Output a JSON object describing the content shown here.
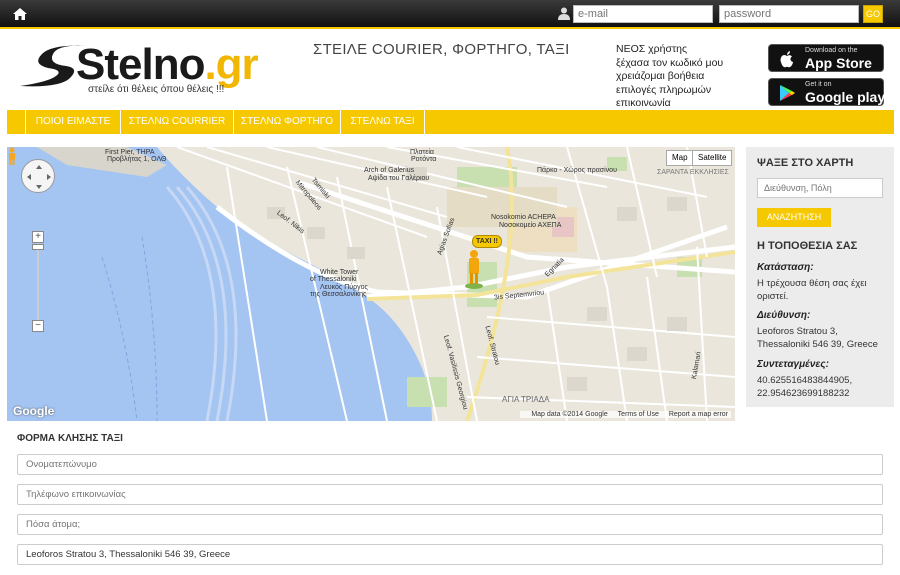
{
  "topbar": {
    "email_placeholder": "e-mail",
    "password_placeholder": "password",
    "go_label": "GO"
  },
  "header": {
    "logo_main": "Stelno",
    "logo_ext": ".gr",
    "logo_tagline": "στείλε ότι θέλεις όπου θέλεις !!!",
    "slogan": "ΣΤΕΙΛΕ COURIER, ΦΟΡΤΗΓΟ, ΤΑΞΙ",
    "links": [
      "ΝΕΟΣ χρήστης",
      "ξέχασα τον κωδικό μου",
      "χρειάζομαι βοήθεια",
      "επιλογές πληρωμών",
      "επικοινωνία"
    ],
    "app_store": {
      "small": "Download on the",
      "big": "App Store"
    },
    "google_play": {
      "small": "Get it on",
      "big": "Google play"
    }
  },
  "nav": [
    "ΠΟΙΟΙ ΕΙΜΑΣΤΕ",
    "ΣΤΕΛΝΩ COURRIER",
    "ΣΤΕΛΝΩ ΦΟΡΤΗΓΟ",
    "ΣΤΕΛΝΩ ΤΑΞΙ"
  ],
  "map": {
    "type_map": "Map",
    "type_satellite": "Satellite",
    "google": "Google",
    "footer": [
      "Map data ©2014 Google",
      "Terms of Use",
      "Report a map error"
    ],
    "marker_label": "TAXI !!",
    "labels": {
      "first_pier": "First Pier, THPA",
      "first_pier_gr": "Προβλήτας 1, ΟΛΘ",
      "arch": "Arch of Galerius",
      "arch_gr": "Αψίδα του Γαλέριου",
      "white_tower": "White Tower",
      "white_tower2": "of Thessaloniki",
      "white_tower_gr": "Λευκός Πύργος",
      "white_tower_gr2": "της Θεσσαλονίκης",
      "hospital": "Nosokomio ACHEPA",
      "hospital_gr": "Νοσοκομείο ΑΧΕΠΑ",
      "lefl_nikis": "Leof. Nikis",
      "egnatia": "Egnatia",
      "sept3": "3is Septemvriou",
      "park": "Πάρκο - Χώρος πρασίνου",
      "agia_triada": "ΑΓΙΑ ΤΡΙΑΔΑ",
      "sarantaekklisies": "ΣΑΡΑΝΤΑ ΕΚΚΛΗΣΙΕΣ",
      "plateia": "Πλατεία",
      "rotonda": "Ροτόντα",
      "tsimiski": "Tsimiski",
      "mitropoleos": "Mitropoleos",
      "agias_sofias": "Agias Sofias",
      "lef_stratou": "Leof. Stratou",
      "kalamari": "Kalamari",
      "vasilissis": "Leof. Vasilissis Georgiou"
    }
  },
  "side": {
    "search_title": "ΨΑΞΕ ΣΤΟ ΧΑΡΤΗ",
    "search_placeholder": "Διεύθυνση, Πόλη",
    "search_button": "ΑΝΑΖΗΤΗΣΗ",
    "location_title": "Η ΤΟΠΟΘΕΣΙΑ ΣΑΣ",
    "status_label": "Κατάσταση:",
    "status_value": "Η τρέχουσα θέση σας έχει οριστεί.",
    "address_label": "Διεύθυνση:",
    "address_value": "Leoforos Stratou 3, Thessaloniki 546 39, Greece",
    "coords_label": "Συντεταγμένες:",
    "coords_value": "40.625516483844905, 22.954623699188232"
  },
  "form": {
    "title": "ΦΟΡΜΑ ΚΛΗΣΗΣ ΤΑΞΙ",
    "name_placeholder": "Ονοματεπώνυμο",
    "phone_placeholder": "Τηλέφωνο επικοινωνίας",
    "people_placeholder": "Πόσα άτομα;",
    "address_value": "Leoforos Stratou 3, Thessaloniki 546 39, Greece"
  },
  "colors": {
    "accent": "#f6c800",
    "topbar": "#1c1c1c",
    "sea": "#a4c4f2"
  }
}
